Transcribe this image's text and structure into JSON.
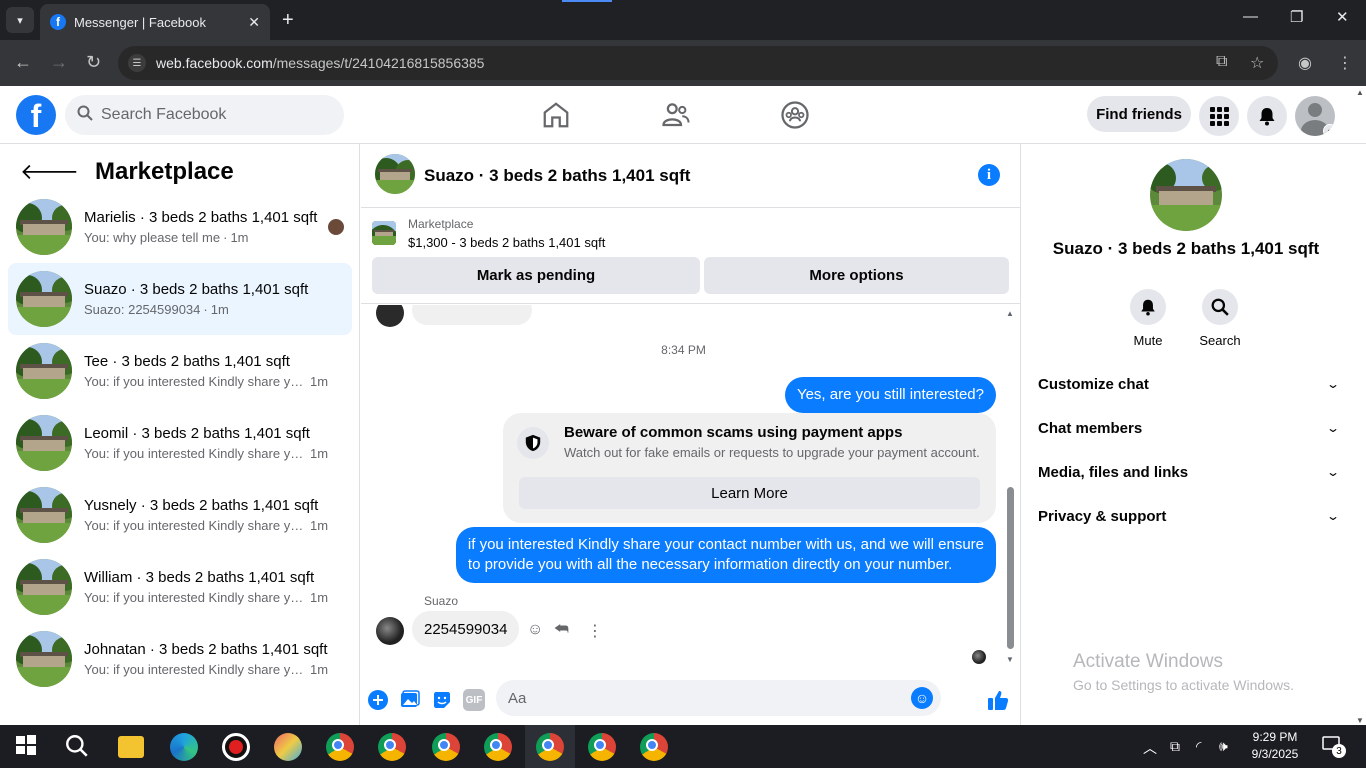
{
  "browser": {
    "tab_title": "Messenger | Facebook",
    "url_host": "web.facebook.com",
    "url_path": "/messages/t/24104216815856385"
  },
  "header": {
    "search_placeholder": "Search Facebook",
    "find_friends": "Find friends",
    "brand_color": "#1877f2"
  },
  "sidebar": {
    "title": "Marketplace",
    "conversations": [
      {
        "name": "Marielis · 3 beds 2 baths 1,401 sqft",
        "preview": "You: why please tell me",
        "time": "1m",
        "active": false
      },
      {
        "name": "Suazo · 3 beds 2 baths 1,401 sqft",
        "preview": "Suazo: 2254599034",
        "time": "1m",
        "active": true
      },
      {
        "name": "Tee · 3 beds 2 baths 1,401 sqft",
        "preview": "You: if you interested Kindly share yo...",
        "time": "1m",
        "active": false
      },
      {
        "name": "Leomil · 3 beds 2 baths 1,401 sqft",
        "preview": "You: if you interested Kindly share yo...",
        "time": "1m",
        "active": false
      },
      {
        "name": "Yusnely · 3 beds 2 baths 1,401 sqft",
        "preview": "You: if you interested Kindly share yo...",
        "time": "1m",
        "active": false
      },
      {
        "name": "William · 3 beds 2 baths 1,401 sqft",
        "preview": "You: if you interested Kindly share yo...",
        "time": "1m",
        "active": false
      },
      {
        "name": "Johnatan · 3 beds 2 baths 1,401 sqft",
        "preview": "You: if you interested Kindly share yo...",
        "time": "1m",
        "active": false
      }
    ]
  },
  "chat": {
    "title": "Suazo · 3 beds 2 baths 1,401 sqft",
    "listing_category": "Marketplace",
    "listing_desc": "$1,300 - 3 beds 2 baths 1,401 sqft",
    "mark_pending": "Mark as pending",
    "more_options": "More options",
    "timestamp": "8:34 PM",
    "msg_out_1": "Yes, are you still interested?",
    "scam_title": "Beware of common scams using payment apps",
    "scam_body": "Watch out for fake emails or requests to upgrade your payment account.",
    "learn_more": "Learn More",
    "msg_out_2_line1": "if you interested Kindly share your contact number with us, and we will ensure",
    "msg_out_2_line2": "to provide you with all the necessary information directly on your number.",
    "sender": "Suazo",
    "msg_in": "2254599034",
    "composer_placeholder": "Aa",
    "gif_label": "GIF",
    "accent_color": "#0a7cff"
  },
  "details": {
    "name": "Suazo · 3 beds 2 baths 1,401 sqft",
    "mute": "Mute",
    "search": "Search",
    "sections": [
      "Customize chat",
      "Chat members",
      "Media, files and links",
      "Privacy & support"
    ]
  },
  "watermark": {
    "line1": "Activate Windows",
    "line2": "Go to Settings to activate Windows."
  },
  "taskbar": {
    "time": "9:29 PM",
    "date": "9/3/2025",
    "notification_count": "3"
  }
}
